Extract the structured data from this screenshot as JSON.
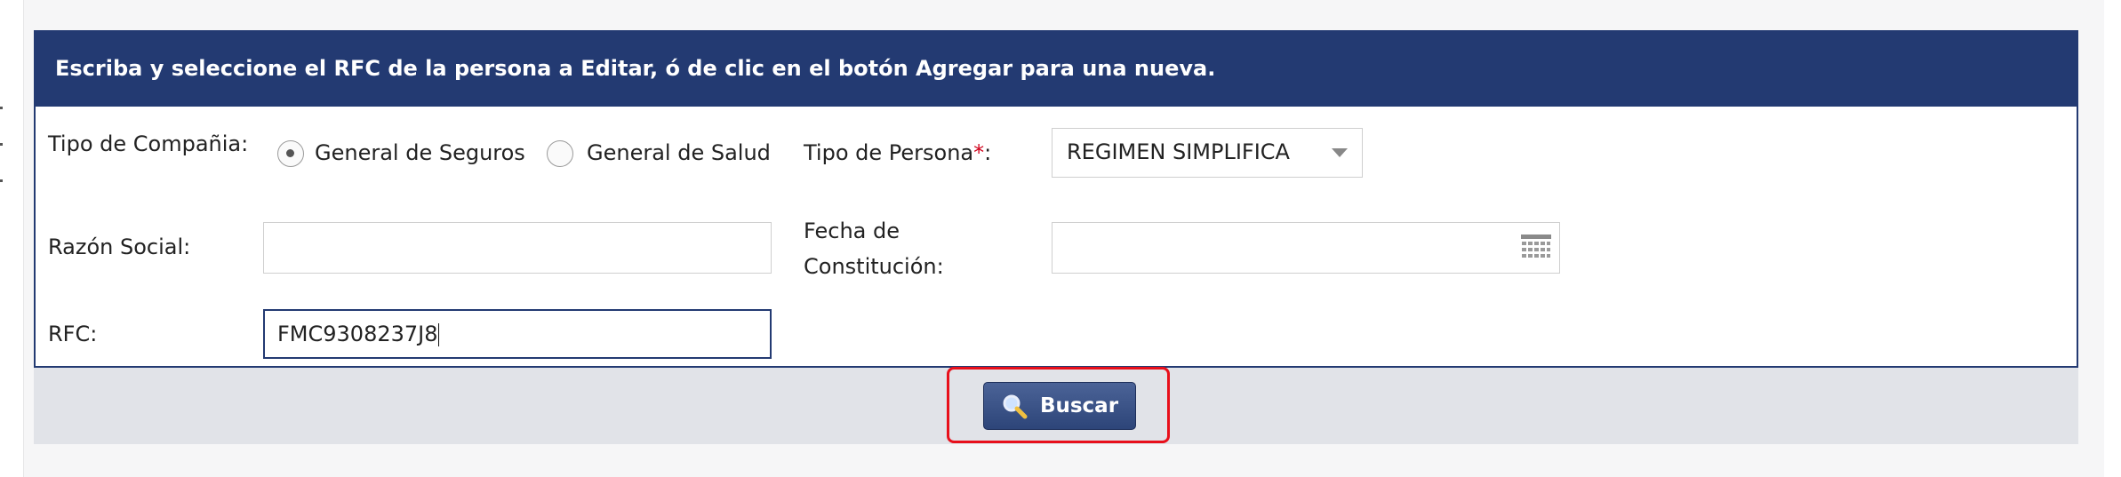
{
  "header": {
    "instruction": "Escriba y seleccione el RFC de la persona a Editar, ó de clic en el botón Agregar para una nueva."
  },
  "form": {
    "company_type": {
      "label": "Tipo de Compañia:",
      "options": [
        {
          "label": "General de Seguros",
          "selected": true
        },
        {
          "label": "General de Salud",
          "selected": false
        }
      ]
    },
    "person_type": {
      "label": "Tipo de Persona",
      "required_mark": "*",
      "label_suffix": ":",
      "selected": "REGIMEN SIMPLIFICA"
    },
    "razon_social": {
      "label": "Razón Social:",
      "value": ""
    },
    "fecha_constitucion": {
      "label_line1": "Fecha de",
      "label_line2": "Constitución:",
      "value": ""
    },
    "rfc": {
      "label": "RFC:",
      "value": "FMC9308237J8"
    }
  },
  "actions": {
    "search_label": "Buscar"
  },
  "colors": {
    "header_bg": "#233a72",
    "highlight": "#e8101b",
    "button_bar": "#e1e3e8"
  }
}
